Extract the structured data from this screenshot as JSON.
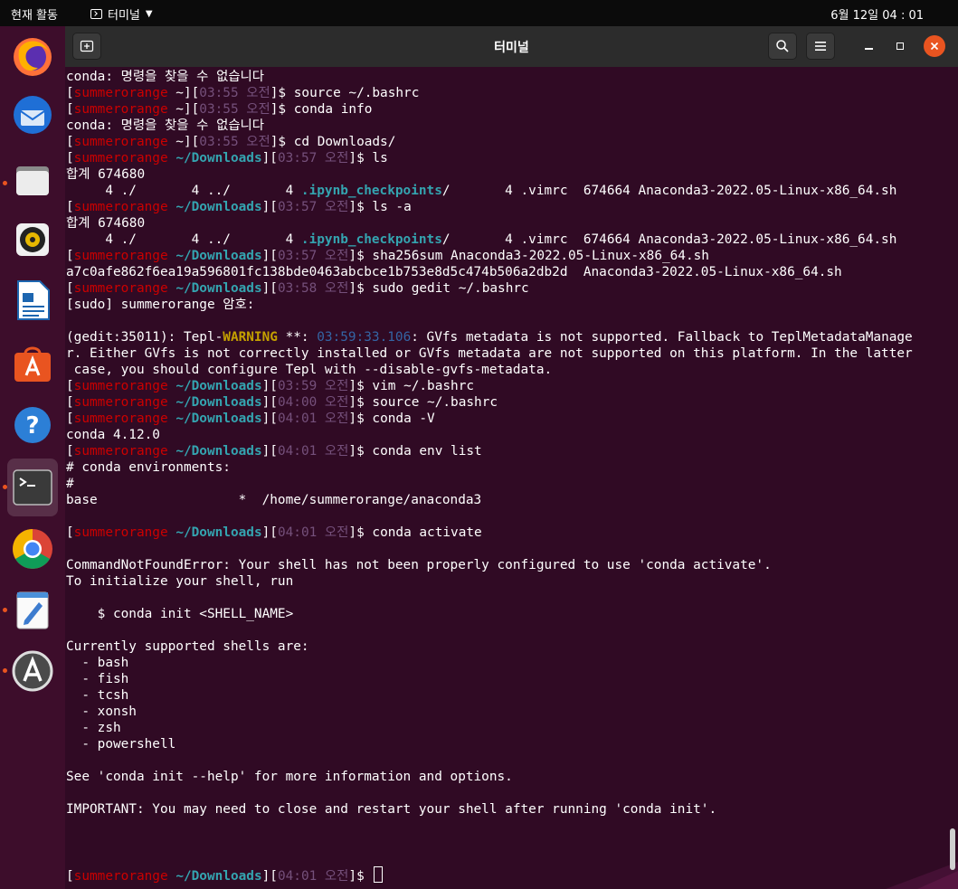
{
  "topbar": {
    "activities": "현재 활동",
    "app_name": "터미널",
    "clock": "6월 12일 04 : 01"
  },
  "window": {
    "title": "터미널"
  },
  "colors": {
    "terminal_bg": "#300a24",
    "user": "#cc0000",
    "path": "#34a4b0",
    "time": "#75507b",
    "warning": "#c4a000",
    "close": "#e95420"
  },
  "dock": {
    "items": [
      "firefox-icon",
      "thunderbird-icon",
      "files-icon",
      "rhythmbox-icon",
      "libreoffice-writer-icon",
      "software-center-icon",
      "help-icon",
      "terminal-icon",
      "chrome-icon",
      "text-editor-icon",
      "software-updater-icon"
    ]
  },
  "terminal": {
    "lines": [
      [
        {
          "t": "conda: 명령을 찾을 수 없습니다"
        }
      ],
      [
        {
          "t": "["
        },
        {
          "t": "summerorange",
          "c": "u"
        },
        {
          "t": " ~]["
        },
        {
          "t": "03:55 오전",
          "c": "t"
        },
        {
          "t": "]$ source ~/.bashrc"
        }
      ],
      [
        {
          "t": "["
        },
        {
          "t": "summerorange",
          "c": "u"
        },
        {
          "t": " ~]["
        },
        {
          "t": "03:55 오전",
          "c": "t"
        },
        {
          "t": "]$ conda info"
        }
      ],
      [
        {
          "t": "conda: 명령을 찾을 수 없습니다"
        }
      ],
      [
        {
          "t": "["
        },
        {
          "t": "summerorange",
          "c": "u"
        },
        {
          "t": " ~]["
        },
        {
          "t": "03:55 오전",
          "c": "t"
        },
        {
          "t": "]$ cd Downloads/"
        }
      ],
      [
        {
          "t": "["
        },
        {
          "t": "summerorange",
          "c": "u"
        },
        {
          "t": " "
        },
        {
          "t": "~/Downloads",
          "c": "p"
        },
        {
          "t": "]["
        },
        {
          "t": "03:57 오전",
          "c": "t"
        },
        {
          "t": "]$ ls"
        }
      ],
      [
        {
          "t": "합계 674680"
        }
      ],
      [
        {
          "t": "     4 ./       4 ../       4 "
        },
        {
          "t": ".ipynb_checkpoints",
          "c": "ip"
        },
        {
          "t": "/       4 .vimrc  674664 Anaconda3-2022.05-Linux-x86_64.sh"
        }
      ],
      [
        {
          "t": "["
        },
        {
          "t": "summerorange",
          "c": "u"
        },
        {
          "t": " "
        },
        {
          "t": "~/Downloads",
          "c": "p"
        },
        {
          "t": "]["
        },
        {
          "t": "03:57 오전",
          "c": "t"
        },
        {
          "t": "]$ ls -a"
        }
      ],
      [
        {
          "t": "합계 674680"
        }
      ],
      [
        {
          "t": "     4 ./       4 ../       4 "
        },
        {
          "t": ".ipynb_checkpoints",
          "c": "ip"
        },
        {
          "t": "/       4 .vimrc  674664 Anaconda3-2022.05-Linux-x86_64.sh"
        }
      ],
      [
        {
          "t": "["
        },
        {
          "t": "summerorange",
          "c": "u"
        },
        {
          "t": " "
        },
        {
          "t": "~/Downloads",
          "c": "p"
        },
        {
          "t": "]["
        },
        {
          "t": "03:57 오전",
          "c": "t"
        },
        {
          "t": "]$ sha256sum Anaconda3-2022.05-Linux-x86_64.sh"
        }
      ],
      [
        {
          "t": "a7c0afe862f6ea19a596801fc138bde0463abcbce1b753e8d5c474b506a2db2d  Anaconda3-2022.05-Linux-x86_64.sh"
        }
      ],
      [
        {
          "t": "["
        },
        {
          "t": "summerorange",
          "c": "u"
        },
        {
          "t": " "
        },
        {
          "t": "~/Downloads",
          "c": "p"
        },
        {
          "t": "]["
        },
        {
          "t": "03:58 오전",
          "c": "t"
        },
        {
          "t": "]$ sudo gedit ~/.bashrc"
        }
      ],
      [
        {
          "t": "[sudo] summerorange 암호:"
        }
      ],
      [
        {
          "t": ""
        }
      ],
      [
        {
          "t": "(gedit:35011): Tepl-"
        },
        {
          "t": "WARNING",
          "c": "w"
        },
        {
          "t": " **: "
        },
        {
          "t": "03:59:33.106",
          "c": "tm"
        },
        {
          "t": ": GVfs metadata is not supported. Fallback to TeplMetadataManage"
        }
      ],
      [
        {
          "t": "r. Either GVfs is not correctly installed or GVfs metadata are not supported on this platform. In the latter"
        }
      ],
      [
        {
          "t": " case, you should configure Tepl with --disable-gvfs-metadata."
        }
      ],
      [
        {
          "t": "["
        },
        {
          "t": "summerorange",
          "c": "u"
        },
        {
          "t": " "
        },
        {
          "t": "~/Downloads",
          "c": "p"
        },
        {
          "t": "]["
        },
        {
          "t": "03:59 오전",
          "c": "t"
        },
        {
          "t": "]$ vim ~/.bashrc"
        }
      ],
      [
        {
          "t": "["
        },
        {
          "t": "summerorange",
          "c": "u"
        },
        {
          "t": " "
        },
        {
          "t": "~/Downloads",
          "c": "p"
        },
        {
          "t": "]["
        },
        {
          "t": "04:00 오전",
          "c": "t"
        },
        {
          "t": "]$ source ~/.bashrc"
        }
      ],
      [
        {
          "t": "["
        },
        {
          "t": "summerorange",
          "c": "u"
        },
        {
          "t": " "
        },
        {
          "t": "~/Downloads",
          "c": "p"
        },
        {
          "t": "]["
        },
        {
          "t": "04:01 오전",
          "c": "t"
        },
        {
          "t": "]$ conda -V"
        }
      ],
      [
        {
          "t": "conda 4.12.0"
        }
      ],
      [
        {
          "t": "["
        },
        {
          "t": "summerorange",
          "c": "u"
        },
        {
          "t": " "
        },
        {
          "t": "~/Downloads",
          "c": "p"
        },
        {
          "t": "]["
        },
        {
          "t": "04:01 오전",
          "c": "t"
        },
        {
          "t": "]$ conda env list"
        }
      ],
      [
        {
          "t": "# conda environments:"
        }
      ],
      [
        {
          "t": "#"
        }
      ],
      [
        {
          "t": "base                  *  /home/summerorange/anaconda3"
        }
      ],
      [
        {
          "t": ""
        }
      ],
      [
        {
          "t": "["
        },
        {
          "t": "summerorange",
          "c": "u"
        },
        {
          "t": " "
        },
        {
          "t": "~/Downloads",
          "c": "p"
        },
        {
          "t": "]["
        },
        {
          "t": "04:01 오전",
          "c": "t"
        },
        {
          "t": "]$ conda activate"
        }
      ],
      [
        {
          "t": ""
        }
      ],
      [
        {
          "t": "CommandNotFoundError: Your shell has not been properly configured to use 'conda activate'."
        }
      ],
      [
        {
          "t": "To initialize your shell, run"
        }
      ],
      [
        {
          "t": ""
        }
      ],
      [
        {
          "t": "    $ conda init <SHELL_NAME>"
        }
      ],
      [
        {
          "t": ""
        }
      ],
      [
        {
          "t": "Currently supported shells are:"
        }
      ],
      [
        {
          "t": "  - bash"
        }
      ],
      [
        {
          "t": "  - fish"
        }
      ],
      [
        {
          "t": "  - tcsh"
        }
      ],
      [
        {
          "t": "  - xonsh"
        }
      ],
      [
        {
          "t": "  - zsh"
        }
      ],
      [
        {
          "t": "  - powershell"
        }
      ],
      [
        {
          "t": ""
        }
      ],
      [
        {
          "t": "See 'conda init --help' for more information and options."
        }
      ],
      [
        {
          "t": ""
        }
      ],
      [
        {
          "t": "IMPORTANT: You may need to close and restart your shell after running 'conda init'."
        }
      ],
      [
        {
          "t": ""
        }
      ],
      [
        {
          "t": ""
        }
      ],
      [
        {
          "t": ""
        }
      ],
      [
        {
          "t": "["
        },
        {
          "t": "summerorange",
          "c": "u"
        },
        {
          "t": " "
        },
        {
          "t": "~/Downloads",
          "c": "p"
        },
        {
          "t": "]["
        },
        {
          "t": "04:01 오전",
          "c": "t"
        },
        {
          "t": "]$ "
        },
        {
          "cursor": true
        }
      ]
    ]
  }
}
